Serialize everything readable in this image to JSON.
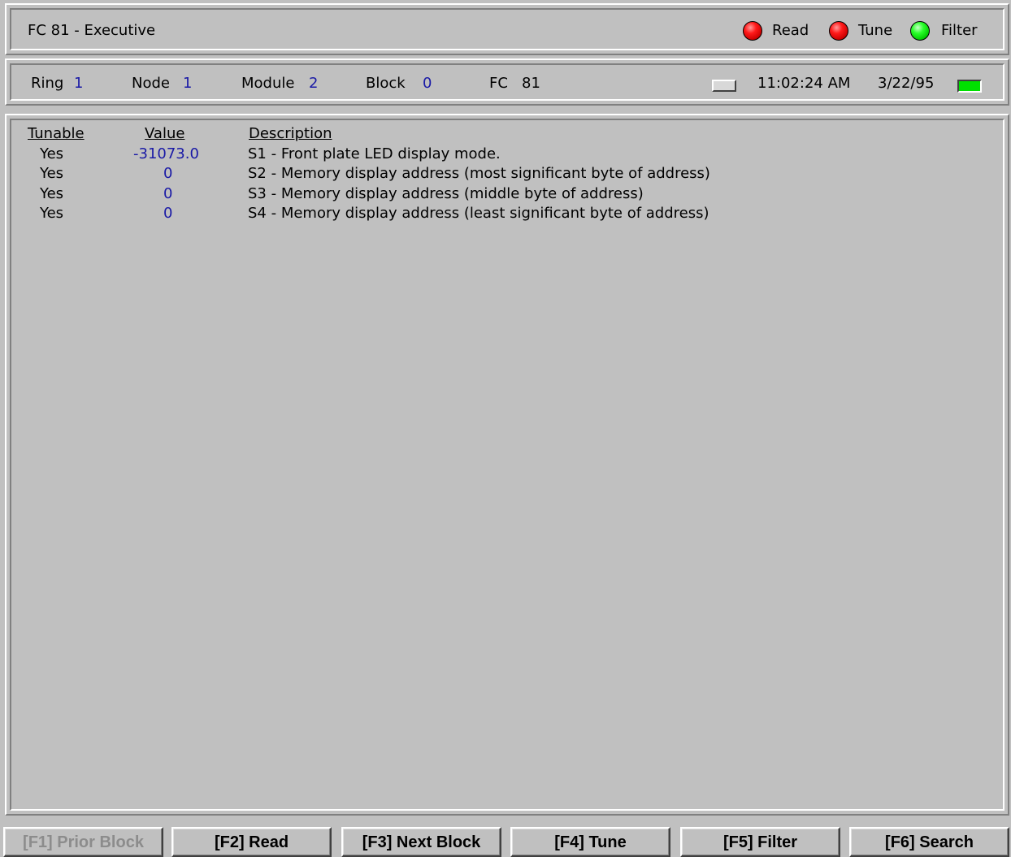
{
  "title": "FC 81 - Executive",
  "indicators": [
    {
      "label": "Read",
      "color": "#ff0000",
      "icon": "red-led-icon"
    },
    {
      "label": "Tune",
      "color": "#ff0000",
      "icon": "red-led-icon"
    },
    {
      "label": "Filter",
      "color": "#00e000",
      "icon": "green-led-icon"
    }
  ],
  "status": {
    "ring_label": "Ring",
    "ring_value": "1",
    "node_label": "Node",
    "node_value": "1",
    "module_label": "Module",
    "module_value": "2",
    "block_label": "Block",
    "block_value": "0",
    "fc_label": "FC",
    "fc_value": "81",
    "time": "11:02:24 AM",
    "date": "3/22/95"
  },
  "table": {
    "headers": {
      "tunable": "Tunable",
      "value": "Value",
      "description": "Description"
    },
    "rows": [
      {
        "tunable": "Yes",
        "value": "-31073.0",
        "description": "S1 - Front plate LED display mode."
      },
      {
        "tunable": "Yes",
        "value": "0",
        "description": "S2 - Memory display address (most significant byte of address)"
      },
      {
        "tunable": "Yes",
        "value": "0",
        "description": "S3 - Memory display address (middle byte of address)"
      },
      {
        "tunable": "Yes",
        "value": "0",
        "description": "S4 - Memory display address (least significant byte of address)"
      }
    ]
  },
  "function_keys": [
    {
      "label": "[F1] Prior Block",
      "enabled": false
    },
    {
      "label": "[F2] Read",
      "enabled": true
    },
    {
      "label": "[F3] Next Block",
      "enabled": true
    },
    {
      "label": "[F4] Tune",
      "enabled": true
    },
    {
      "label": "[F5] Filter",
      "enabled": true
    },
    {
      "label": "[F6] Search",
      "enabled": true
    }
  ],
  "colors": {
    "background": "#c0c0c0",
    "value_text": "#1a1aa6",
    "disabled_text": "#8c8c8c"
  }
}
